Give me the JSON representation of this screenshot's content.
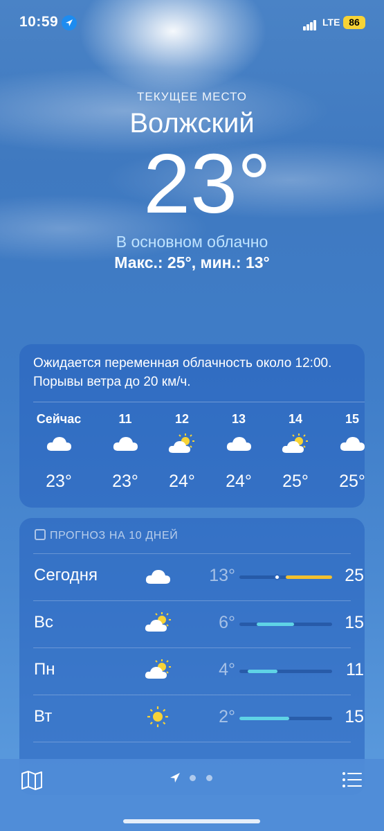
{
  "status": {
    "time": "10:59",
    "network": "LTE",
    "battery": "86"
  },
  "location": {
    "subtitle": "ТЕКУЩЕЕ МЕСТО",
    "city": "Волжский",
    "temperature": "23°",
    "condition": "В основном облачно",
    "high_low": "Макс.: 25°, мин.: 13°"
  },
  "hourly": {
    "summary": "Ожидается переменная облачность около 12:00. Порывы ветра до 20 км/ч.",
    "items": [
      {
        "label": "Сейчас",
        "icon": "cloud-icon",
        "temp": "23°"
      },
      {
        "label": "11",
        "icon": "cloud-icon",
        "temp": "23°"
      },
      {
        "label": "12",
        "icon": "partly-sunny-icon",
        "temp": "24°"
      },
      {
        "label": "13",
        "icon": "cloud-icon",
        "temp": "24°"
      },
      {
        "label": "14",
        "icon": "partly-sunny-icon",
        "temp": "25°"
      },
      {
        "label": "15",
        "icon": "cloud-icon",
        "temp": "25°"
      }
    ]
  },
  "forecast": {
    "header": "ПРОГНОЗ НА 10 ДНЕЙ",
    "days": [
      {
        "day": "Сегодня",
        "icon": "cloud-icon",
        "low": "13°",
        "high": "25°",
        "range_start": 0.5,
        "range_end": 1.0,
        "color": "#f2c02e",
        "current_marker": true
      },
      {
        "day": "Вс",
        "icon": "partly-sunny-icon",
        "low": "6°",
        "high": "15°",
        "range_start": 0.19,
        "range_end": 0.59,
        "color": "#5fd3e6"
      },
      {
        "day": "Пн",
        "icon": "partly-sunny-icon",
        "low": "4°",
        "high": "11°",
        "range_start": 0.09,
        "range_end": 0.41,
        "color": "#5fd3e6"
      },
      {
        "day": "Вт",
        "icon": "sun-icon",
        "low": "2°",
        "high": "15°",
        "range_start": 0.0,
        "range_end": 0.54,
        "color": "#5fd3e6"
      }
    ]
  },
  "colors": {
    "accent_sky": "#3f7dc8",
    "condition_text": "#bfe3ff",
    "warm_bar": "#f2c02e",
    "cool_bar": "#5fd3e6"
  }
}
